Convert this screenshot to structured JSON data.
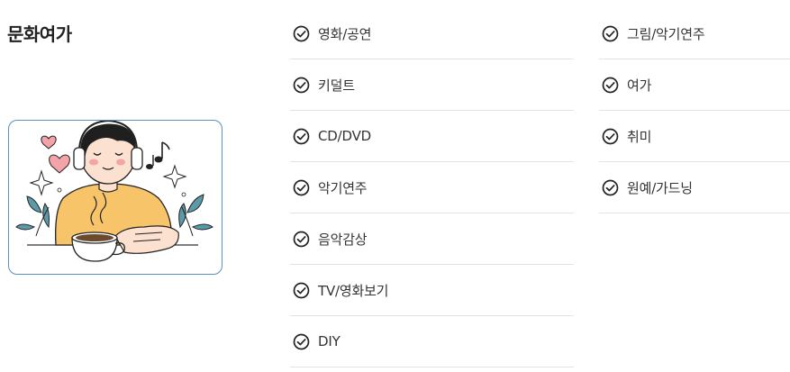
{
  "category": {
    "title": "문화여가"
  },
  "illustration": {
    "icon": "man-with-headphones-and-coffee-illustration",
    "border_color": "#5a8fbf"
  },
  "options": {
    "check_icon": "circle-check-icon",
    "column1": [
      {
        "label": "영화/공연"
      },
      {
        "label": "키덜트"
      },
      {
        "label": "CD/DVD"
      },
      {
        "label": "악기연주"
      },
      {
        "label": "음악감상"
      },
      {
        "label": "TV/영화보기"
      },
      {
        "label": "DIY"
      }
    ],
    "column2": [
      {
        "label": "그림/악기연주"
      },
      {
        "label": "여가"
      },
      {
        "label": "취미"
      },
      {
        "label": "원예/가드닝"
      }
    ]
  }
}
